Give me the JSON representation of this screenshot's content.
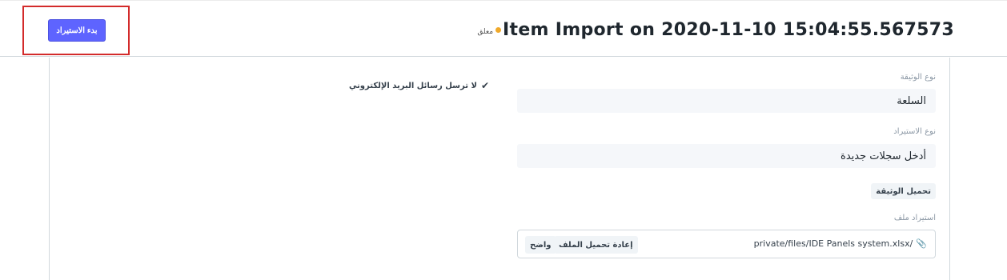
{
  "header": {
    "title": "Item Import on 2020-11-10 15:04:55.567573",
    "status": "معلق",
    "status_color": "#f0a92a",
    "primary_action": "بدء الاستيراد",
    "highlight_color": "#d32b2b"
  },
  "form": {
    "document_type": {
      "label": "نوع الوثيقة",
      "value": "السلعة"
    },
    "import_type": {
      "label": "نوع الاستيراد",
      "value": "أدخل سجلات جديدة"
    },
    "download_template": "تحميل الوثيقة",
    "import_file": {
      "label": "استيراد ملف",
      "file_name": "private/files/IDE Panels system.xlsx/",
      "reload_button": "إعادة تحميل الملف",
      "clear_button": "واضح"
    },
    "email_option": {
      "icon": "check-icon",
      "label": "لا ترسل رسائل البريد الإلكتروني"
    }
  }
}
